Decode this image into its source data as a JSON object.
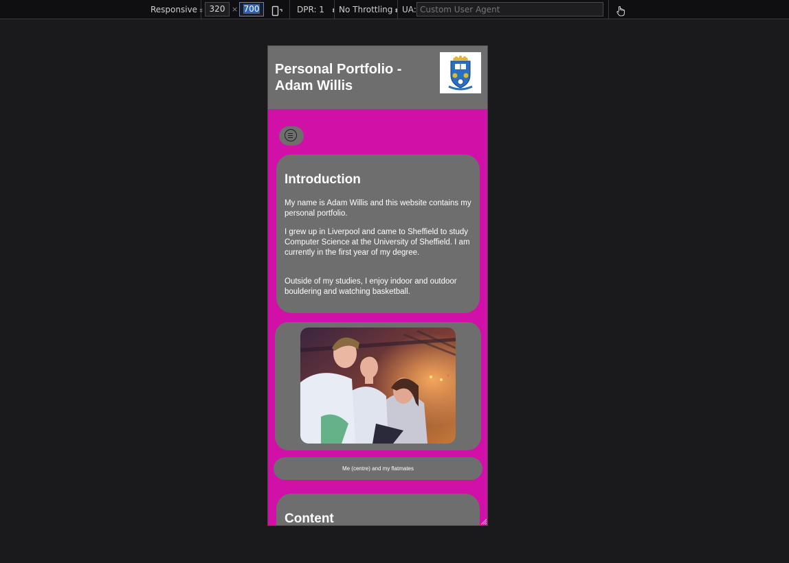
{
  "toolbar": {
    "device": "Responsive",
    "width": "320",
    "times": "×",
    "height": "700",
    "dpr": "DPR: 1",
    "throttling": "No Throttling",
    "ua_label": "UA:",
    "ua_placeholder": "Custom User Agent",
    "icons": [
      "rotate-device-icon",
      "touch-simulation-icon"
    ]
  },
  "site": {
    "title": "Personal Portfolio - Adam Willis",
    "background_color": "#d110a8",
    "panel_color": "#6e6e6e",
    "intro": {
      "heading": "Introduction",
      "paragraphs": [
        "My name is Adam Willis and this website contains my personal portfolio.",
        "I grew up in Liverpool and came to Sheffield to study Computer Science at the University of Sheffield. I am currently in the first year of my degree.",
        "Outside of my studies, I enjoy indoor and outdoor bouldering and watching basketball."
      ]
    },
    "photo_caption": "Me (centre) and my flatmates",
    "content_heading": "Content"
  }
}
